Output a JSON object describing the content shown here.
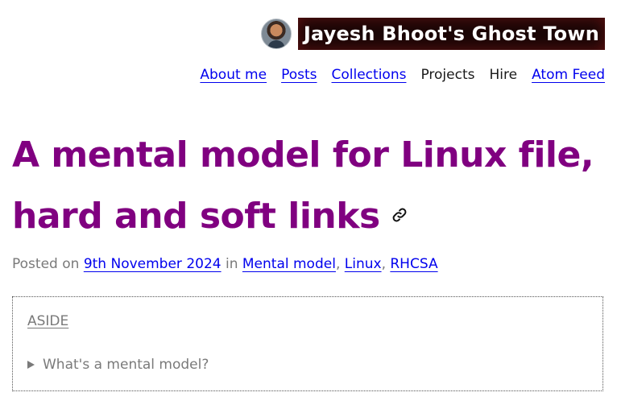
{
  "site": {
    "title": "Jayesh Bhoot's Ghost Town",
    "avatar_alt": "avatar"
  },
  "nav": {
    "items": [
      {
        "label": "About me",
        "link": true
      },
      {
        "label": "Posts",
        "link": true
      },
      {
        "label": "Collections",
        "link": true
      },
      {
        "label": "Projects",
        "link": false
      },
      {
        "label": "Hire",
        "link": false
      },
      {
        "label": "Atom Feed",
        "link": true
      }
    ]
  },
  "post": {
    "title": "A mental model for Linux file, hard and soft links",
    "permalink_icon": "link-icon",
    "meta": {
      "posted_on": "Posted on",
      "date": "9th November 2024",
      "in": "in",
      "categories": [
        "Mental model",
        "Linux",
        "RHCSA"
      ],
      "separator": ","
    }
  },
  "aside": {
    "label": "ASIDE",
    "summary": "What's a mental model?"
  },
  "colors": {
    "title": "#800080",
    "link": "#0000ee",
    "muted": "#7a7a7a",
    "brand_bg": "#1a0606"
  }
}
